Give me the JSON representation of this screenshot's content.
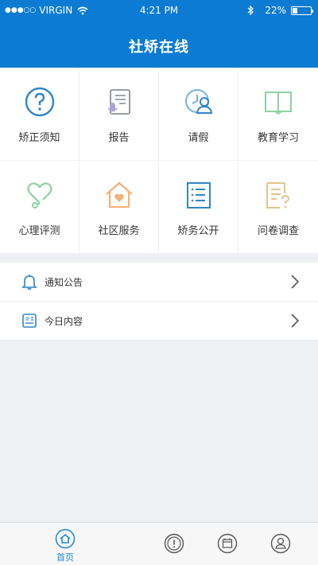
{
  "status_bar": {
    "carrier": "VIRGIN",
    "time": "4:21 PM",
    "battery": "22%"
  },
  "header": {
    "title": "社矫在线"
  },
  "grid_items": [
    {
      "label": "矫正须知",
      "icon": "question-circle-icon"
    },
    {
      "label": "报告",
      "icon": "scroll-microphone-icon"
    },
    {
      "label": "请假",
      "icon": "clock-person-icon"
    },
    {
      "label": "教育学习",
      "icon": "open-book-icon"
    },
    {
      "label": "心理评测",
      "icon": "heart-stethoscope-icon"
    },
    {
      "label": "社区服务",
      "icon": "house-heart-icon"
    },
    {
      "label": "矫务公开",
      "icon": "list-document-icon"
    },
    {
      "label": "问卷调查",
      "icon": "document-question-icon"
    }
  ],
  "list_items": [
    {
      "label": "通知公告",
      "icon": "bell-icon"
    },
    {
      "label": "今日内容",
      "icon": "newspaper-icon"
    }
  ],
  "tabbar": {
    "home_label": "首页"
  },
  "colors": {
    "primary": "#0c7bd3",
    "icon_blue": "#2f86c9",
    "icon_green": "#8fd1a3",
    "icon_orange": "#f2b27a",
    "icon_purple": "#a9a4d9"
  }
}
